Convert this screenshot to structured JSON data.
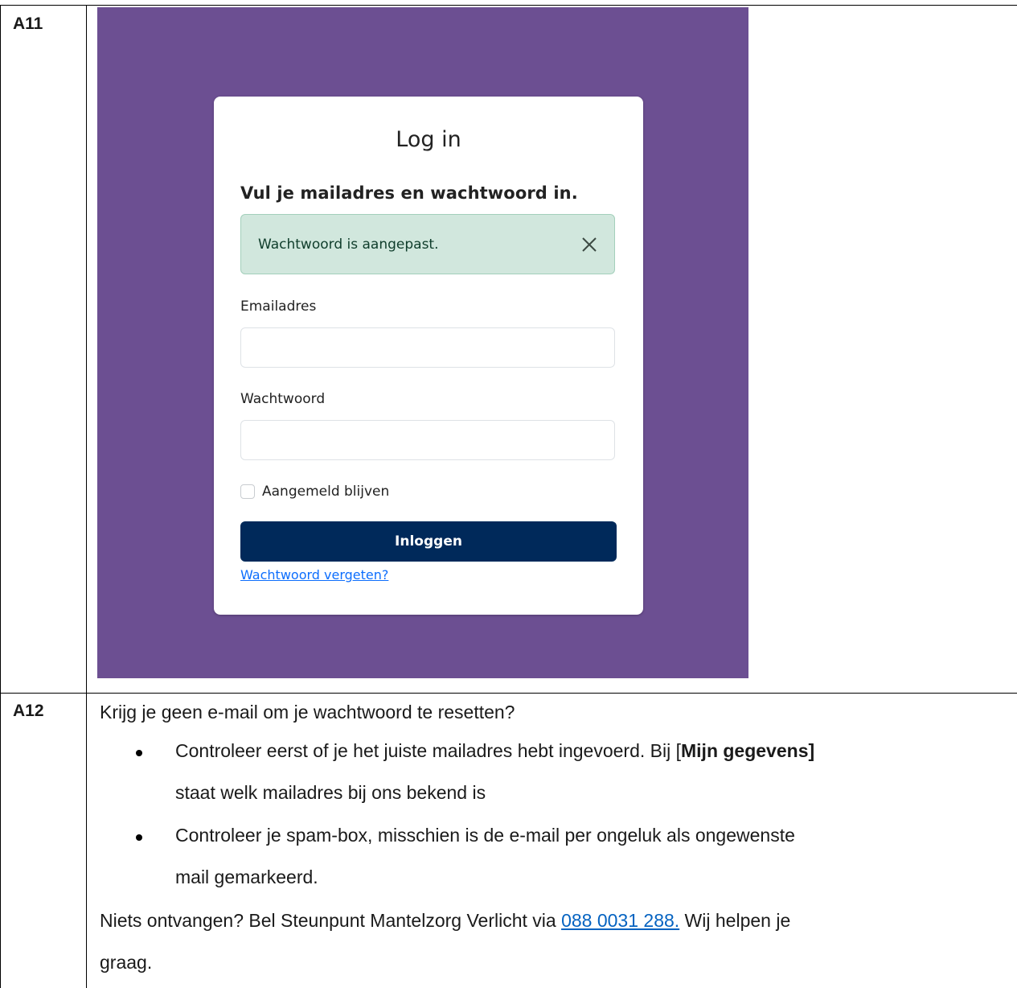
{
  "rows": [
    {
      "label": "A11"
    },
    {
      "label": "A12"
    }
  ],
  "login": {
    "title": "Log in",
    "subtitle": "Vul je mailadres en wachtwoord in.",
    "alert": {
      "text": "Wachtwoord is aangepast.",
      "close_icon": "close-icon"
    },
    "email": {
      "label": "Emailadres",
      "value": "",
      "placeholder": ""
    },
    "password": {
      "label": "Wachtwoord",
      "value": "",
      "placeholder": ""
    },
    "remember": {
      "label": "Aangemeld blijven",
      "checked": false
    },
    "submit_label": "Inloggen",
    "forgot_link": "Wachtwoord vergeten?",
    "colors": {
      "background": "#6c4f92",
      "button": "#00295a",
      "alert_bg": "#d1e7dd",
      "link": "#0d6efd"
    }
  },
  "a12": {
    "intro": "Krijg je geen e-mail om je wachtwoord te resetten?",
    "bullet1_line1_pre": "Controleer eerst of je het juiste mailadres hebt ingevoerd. Bij [",
    "bullet1_bold": "Mijn gegevens]",
    "bullet1_line2": "staat welk mailadres bij ons bekend is",
    "bullet2_line1": "Controleer je spam-box, misschien is de e-mail per ongeluk als ongewenste",
    "bullet2_line2": "mail gemarkeerd.",
    "closing_pre": "Niets ontvangen? Bel Steunpunt Mantelzorg Verlicht via ",
    "phone": "088 0031 288.",
    "closing_post": " Wij helpen je",
    "closing_line2": "graag."
  }
}
